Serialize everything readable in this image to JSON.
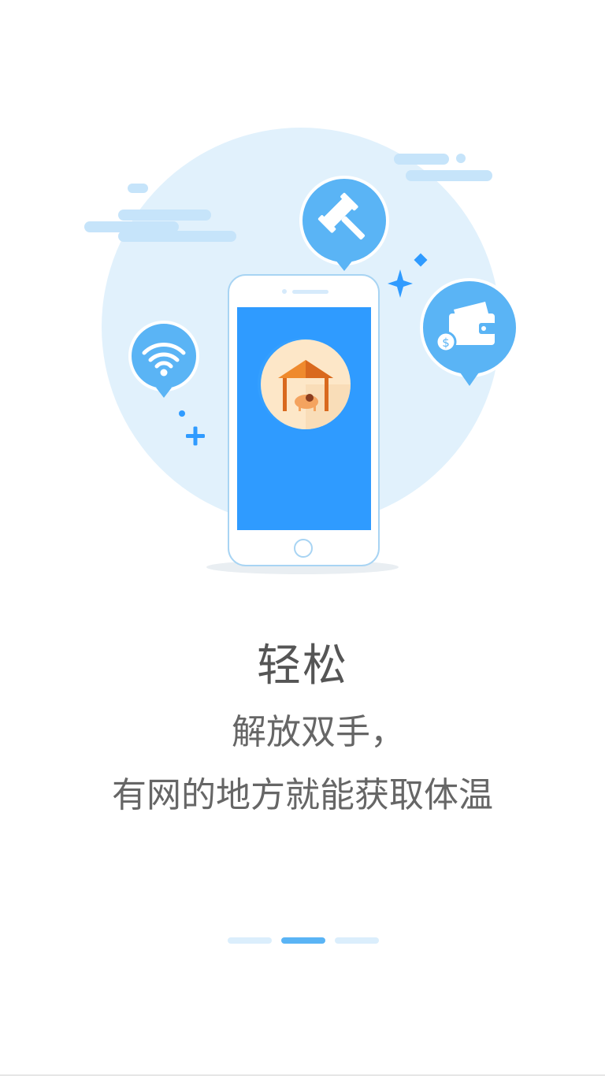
{
  "onboarding": {
    "title": "轻松",
    "subtitle_line1": "解放双手，",
    "subtitle_line2": "有网的地方就能获取体温"
  },
  "pager": {
    "page_count": 3,
    "current_page": 2
  },
  "icons": {
    "hero": "phone-illustration",
    "gavel": "gavel-icon",
    "wifi": "wifi-icon",
    "wallet": "wallet-icon",
    "app": "house-logo-icon"
  },
  "colors": {
    "accent": "#2f9bff",
    "light_blue": "#e1f1fc",
    "bubble": "#5ab4f5",
    "active_dot": "#5ab4f5",
    "inactive_dot": "#dbeefc",
    "text": "#555555"
  }
}
